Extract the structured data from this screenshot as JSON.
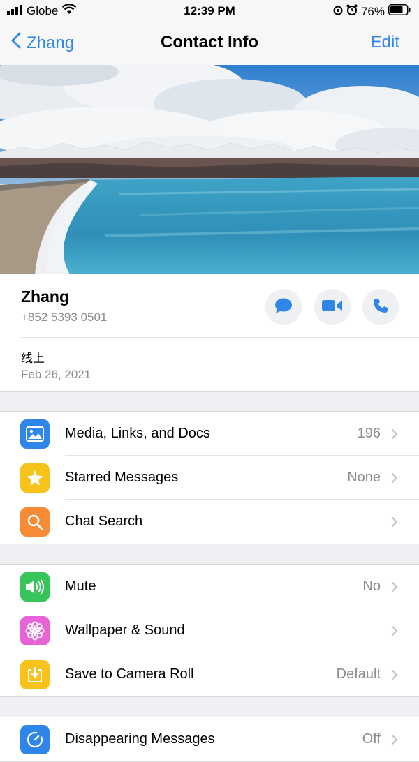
{
  "status_bar": {
    "carrier": "Globe",
    "time": "12:39 PM",
    "battery": "76%"
  },
  "nav": {
    "back_label": "Zhang",
    "title": "Contact Info",
    "edit_label": "Edit"
  },
  "contact": {
    "name": "Zhang",
    "phone": "+852 5393 0501",
    "status": "线上",
    "status_date": "Feb 26, 2021"
  },
  "groups": {
    "g1": [
      {
        "label": "Media, Links, and Docs",
        "value": "196",
        "icon": "photo-icon",
        "color": "#2f86e8"
      },
      {
        "label": "Starred Messages",
        "value": "None",
        "icon": "star-icon",
        "color": "#f7c21a"
      },
      {
        "label": "Chat Search",
        "value": "",
        "icon": "search-icon",
        "color": "#f58b36"
      }
    ],
    "g2": [
      {
        "label": "Mute",
        "value": "No",
        "icon": "speaker-icon",
        "color": "#37c45a"
      },
      {
        "label": "Wallpaper & Sound",
        "value": "",
        "icon": "flower-icon",
        "color": "#e864d6"
      },
      {
        "label": "Save to Camera Roll",
        "value": "Default",
        "icon": "download-icon",
        "color": "#f7c21a"
      }
    ],
    "g3": [
      {
        "label": "Disappearing Messages",
        "value": "Off",
        "icon": "timer-icon",
        "color": "#2f86e8"
      }
    ]
  }
}
